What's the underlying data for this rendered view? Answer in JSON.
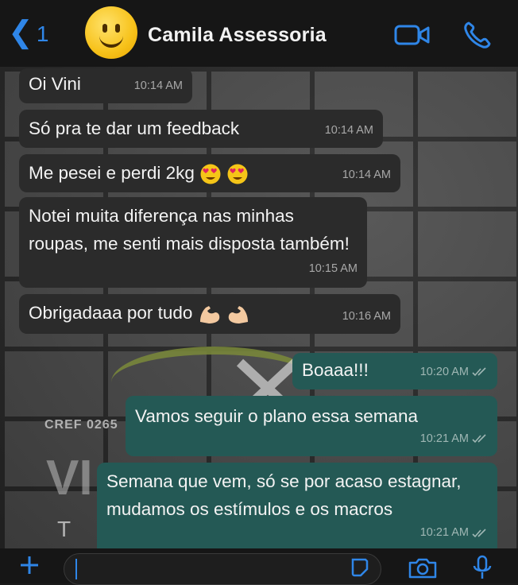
{
  "header": {
    "back_count": "1",
    "contact_name": "Camila Assessoria"
  },
  "colors": {
    "accent": "#2f86e8",
    "incoming_bubble": "#2b2b2b",
    "outgoing_bubble": "#245955",
    "header_bg": "#161616"
  },
  "background": {
    "cref_text": "CREF 0265",
    "big_text": "VI",
    "tr_text": "T R"
  },
  "messages": [
    {
      "direction": "incoming",
      "text": "Oi Vini",
      "time": "10:14 AM"
    },
    {
      "direction": "incoming",
      "text": "Só pra te dar um feedback",
      "time": "10:14 AM"
    },
    {
      "direction": "incoming",
      "text": "Me pesei e perdi 2kg",
      "emojis": [
        "heart-eyes-emoji",
        "heart-eyes-emoji"
      ],
      "time": "10:14 AM"
    },
    {
      "direction": "incoming",
      "text": "Notei muita diferença nas minhas roupas, me senti mais disposta também!",
      "time": "10:15 AM"
    },
    {
      "direction": "incoming",
      "text": "Obrigadaaa por tudo",
      "emojis": [
        "flexed-biceps-emoji",
        "flexed-biceps-emoji"
      ],
      "time": "10:16 AM"
    },
    {
      "direction": "outgoing",
      "text": "Boaaa!!!",
      "time": "10:20 AM",
      "status": "read-check-icon"
    },
    {
      "direction": "outgoing",
      "text": "Vamos seguir o plano essa semana",
      "time": "10:21 AM",
      "status": "read-check-icon"
    },
    {
      "direction": "outgoing",
      "text": "Semana que vem, só se por acaso estagnar, mudamos os estímulos e os macros",
      "time": "10:21 AM",
      "status": "read-check-icon"
    }
  ],
  "icons": [
    "chevron-left-icon",
    "video-call-icon",
    "phone-icon",
    "plus-icon",
    "sticker-icon",
    "camera-icon",
    "microphone-icon"
  ]
}
